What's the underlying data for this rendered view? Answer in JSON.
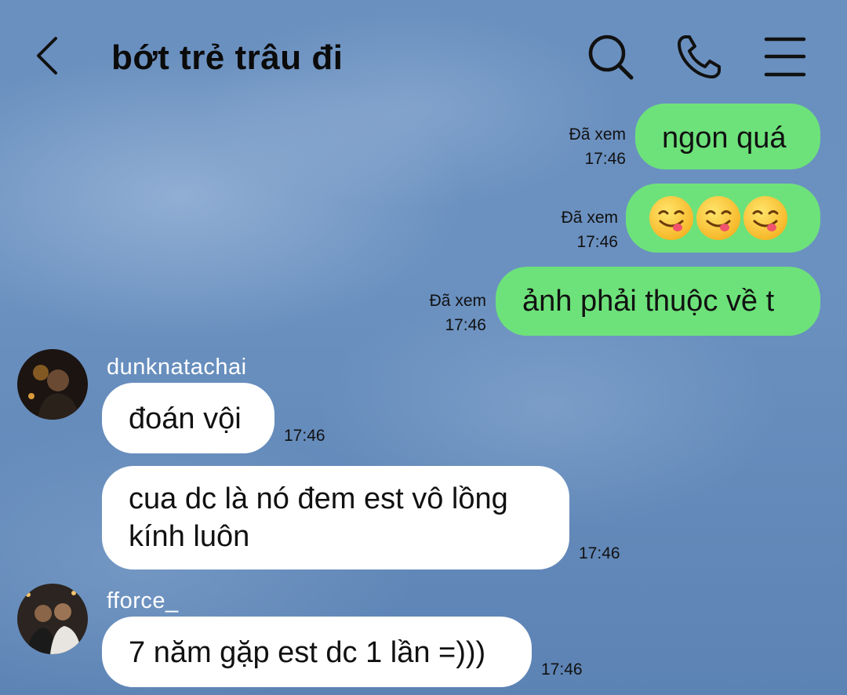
{
  "header": {
    "title": "bớt trẻ trâu đi"
  },
  "messages": [
    {
      "id": "m1",
      "direction": "out",
      "text": "ngon quá",
      "status": "Đã xem",
      "time": "17:46"
    },
    {
      "id": "m2",
      "direction": "out",
      "emoji": [
        "yum-emoji",
        "yum-emoji",
        "yum-emoji"
      ],
      "status": "Đã xem",
      "time": "17:46"
    },
    {
      "id": "m3",
      "direction": "out",
      "text": "ảnh phải thuộc về t",
      "status": "Đã xem",
      "time": "17:46"
    },
    {
      "id": "m4",
      "direction": "in",
      "sender": "dunknatachai",
      "text": "đoán vội",
      "time": "17:46"
    },
    {
      "id": "m5",
      "direction": "in",
      "text_lines": [
        "cua dc là nó đem est vô lồng",
        "kính luôn"
      ],
      "time": "17:46"
    },
    {
      "id": "m6",
      "direction": "in",
      "sender": "fforce_",
      "text": "7 năm gặp est dc 1 lần =)))",
      "time": "17:46"
    }
  ],
  "colors": {
    "outgoing_bubble": "#6de27a",
    "incoming_bubble": "#ffffff",
    "background": "#6a90bf"
  }
}
